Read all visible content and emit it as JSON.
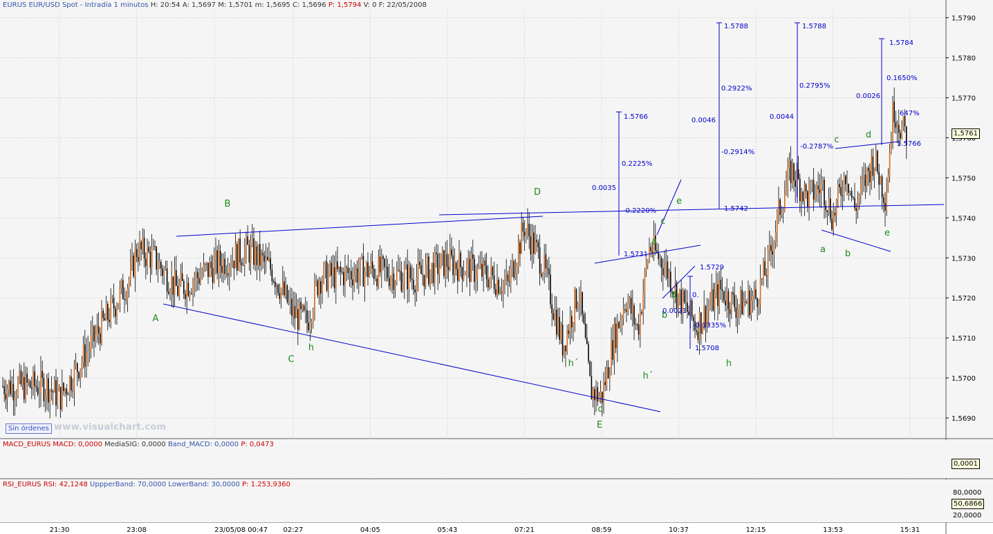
{
  "main_header": {
    "symbol": "EURUS",
    "description": "EUR/USD Spot - Intradía 1 minutos",
    "h_label": "H:",
    "h_val": "20:54",
    "a_label": "A:",
    "a_val": "1,5697",
    "m_label": "M:",
    "m_val": "1,5701",
    "mm_label": "m:",
    "mm_val": "1,5695",
    "c_label": "C:",
    "c_val": "1,5696",
    "p_label": "P:",
    "p_val": "1,5794",
    "v_label": "V:",
    "v_val": "0",
    "f_label": "F:",
    "f_val": "22/05/2008"
  },
  "current_price": "1,5761",
  "orders_button": "Sin órdenes",
  "watermark": "www.visualchart.com",
  "macd_header": {
    "name": "MACD_EURUS",
    "macd": "MACD: 0,0000",
    "signal": "MediaSIG: 0,0000",
    "band": "Band_MACD: 0,0000",
    "p": "P: 0,0473"
  },
  "macd_value": "0,0001",
  "rsi_header": {
    "name": "RSI_EURUS",
    "rsi": "RSI: 42,1248",
    "upper": "UppperBand: 70,0000",
    "lower": "LowerBand: 30,0000",
    "p": "P: 1.253,9360"
  },
  "rsi_axis": [
    "80,0000",
    "50,6866",
    "20,0000"
  ],
  "colors": {
    "up": "#d2691e",
    "down": "#000000",
    "lines": "#0000cc",
    "labels": "#1a8a1a",
    "macd": "#cc0000",
    "rsi": "#cc0000"
  },
  "chart_data": {
    "type": "candlestick",
    "title": "EUR/USD Spot - Intradía 1 minutos",
    "y_ticks": [
      "1,5690",
      "1,5700",
      "1,5710",
      "1,5720",
      "1,5730",
      "1,5740",
      "1,5750",
      "1,5760",
      "1,5770",
      "1,5780",
      "1,5790"
    ],
    "ylim": [
      1.5685,
      1.5792
    ],
    "x_ticks": [
      "21:30",
      "23:08",
      "23/05/08 00:47",
      "02:27",
      "04:05",
      "05:43",
      "07:21",
      "08:59",
      "10:37",
      "12:15",
      "13:53",
      "15:31"
    ],
    "price_path": {
      "x": [
        "21:15",
        "21:30",
        "22:00",
        "22:30",
        "23:00",
        "23:08",
        "23:30",
        "00:00",
        "00:47",
        "01:30",
        "02:00",
        "02:27",
        "02:45",
        "03:00",
        "04:05",
        "05:00",
        "05:43",
        "06:30",
        "07:00",
        "07:21",
        "07:45",
        "08:10",
        "08:30",
        "08:45",
        "08:59",
        "09:15",
        "09:30",
        "09:45",
        "10:00",
        "10:20",
        "10:37",
        "11:00",
        "11:30",
        "11:50",
        "12:15",
        "12:30",
        "12:45",
        "13:00",
        "13:20",
        "13:40",
        "13:53",
        "14:10",
        "14:20",
        "14:45",
        "15:00",
        "15:10",
        "15:20",
        "15:31"
      ],
      "y": [
        1.5698,
        1.5695,
        1.5705,
        1.5715,
        1.5725,
        1.5732,
        1.573,
        1.5722,
        1.5728,
        1.5732,
        1.5727,
        1.5716,
        1.5714,
        1.5725,
        1.5727,
        1.5725,
        1.5729,
        1.5726,
        1.5723,
        1.5738,
        1.5728,
        1.5708,
        1.5722,
        1.5697,
        1.5695,
        1.571,
        1.572,
        1.5712,
        1.5733,
        1.5728,
        1.572,
        1.5713,
        1.5722,
        1.5718,
        1.572,
        1.5728,
        1.5742,
        1.5752,
        1.5745,
        1.5748,
        1.574,
        1.5752,
        1.5742,
        1.5755,
        1.5745,
        1.5768,
        1.5762,
        1.576
      ]
    },
    "wave_labels": [
      "A",
      "B",
      "C",
      "h",
      "D",
      "h´",
      "c",
      "E",
      "h´",
      "a",
      "b",
      "c",
      "d",
      "e",
      "h",
      "a",
      "b",
      "c",
      "d",
      "e"
    ],
    "annotations": [
      "1.5766",
      "0.2225%",
      "0.0035",
      "-0.2220%",
      "1.5731",
      "1.5788",
      "0.2922%",
      "0.0046",
      "-0.2914%",
      "1.5742",
      "0.0021",
      "-0.1335%",
      "1.5729",
      "1.5708",
      "0.",
      "1.5788",
      "0.2795%",
      "0.0044",
      "-0.2787%",
      "1.5784",
      "0.1650%",
      "0.0026",
      "647%",
      "1.5766"
    ],
    "macd": {
      "value": "0,0001"
    },
    "rsi": {
      "upper_band": 70,
      "lower_band": 30,
      "value": 50.6866
    }
  }
}
